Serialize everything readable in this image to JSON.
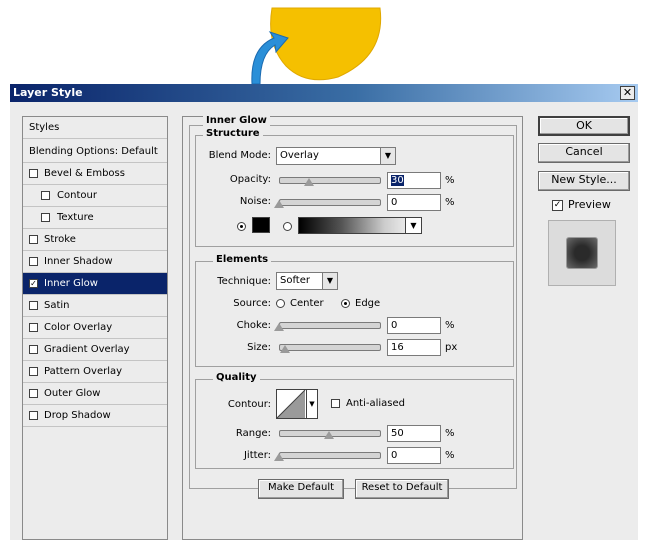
{
  "window": {
    "title": "Layer Style",
    "close_glyph": "✕"
  },
  "left_panel": {
    "items": [
      {
        "label": "Styles",
        "type": "header",
        "checked": false
      },
      {
        "label": "Blending Options: Default",
        "type": "header",
        "checked": false
      },
      {
        "label": "Bevel & Emboss",
        "type": "check",
        "checked": false
      },
      {
        "label": "Contour",
        "type": "sub",
        "checked": false
      },
      {
        "label": "Texture",
        "type": "sub",
        "checked": false
      },
      {
        "label": "Stroke",
        "type": "check",
        "checked": false
      },
      {
        "label": "Inner Shadow",
        "type": "check",
        "checked": false
      },
      {
        "label": "Inner Glow",
        "type": "check",
        "checked": true,
        "selected": true
      },
      {
        "label": "Satin",
        "type": "check",
        "checked": false
      },
      {
        "label": "Color Overlay",
        "type": "check",
        "checked": false
      },
      {
        "label": "Gradient Overlay",
        "type": "check",
        "checked": false
      },
      {
        "label": "Pattern Overlay",
        "type": "check",
        "checked": false
      },
      {
        "label": "Outer Glow",
        "type": "check",
        "checked": false
      },
      {
        "label": "Drop Shadow",
        "type": "check",
        "checked": false
      }
    ]
  },
  "inner_glow": {
    "title": "Inner Glow",
    "structure": {
      "title": "Structure",
      "blend_mode_label": "Blend Mode:",
      "blend_mode_value": "Overlay",
      "opacity_label": "Opacity:",
      "opacity_value": "30",
      "opacity_fraction": 0.3,
      "noise_label": "Noise:",
      "noise_value": "0",
      "noise_fraction": 0,
      "percent": "%",
      "color_swatch": "#000000"
    },
    "elements": {
      "title": "Elements",
      "technique_label": "Technique:",
      "technique_value": "Softer",
      "source_label": "Source:",
      "source_center": "Center",
      "source_edge": "Edge",
      "choke_label": "Choke:",
      "choke_value": "0",
      "choke_fraction": 0,
      "size_label": "Size:",
      "size_value": "16",
      "size_fraction": 0.06,
      "percent": "%",
      "px": "px"
    },
    "quality": {
      "title": "Quality",
      "contour_label": "Contour:",
      "anti_aliased_label": "Anti-aliased",
      "range_label": "Range:",
      "range_value": "50",
      "range_fraction": 0.5,
      "jitter_label": "Jitter:",
      "jitter_value": "0",
      "jitter_fraction": 0,
      "percent": "%"
    },
    "make_default": "Make Default",
    "reset_to_default": "Reset to Default"
  },
  "right_panel": {
    "ok": "OK",
    "cancel": "Cancel",
    "new_style": "New Style...",
    "preview_label": "Preview",
    "preview_checked": true
  },
  "colors": {
    "shape_yellow": "#f5c000",
    "arrow_blue": "#2a8fd8",
    "selection": "#0a246a"
  }
}
